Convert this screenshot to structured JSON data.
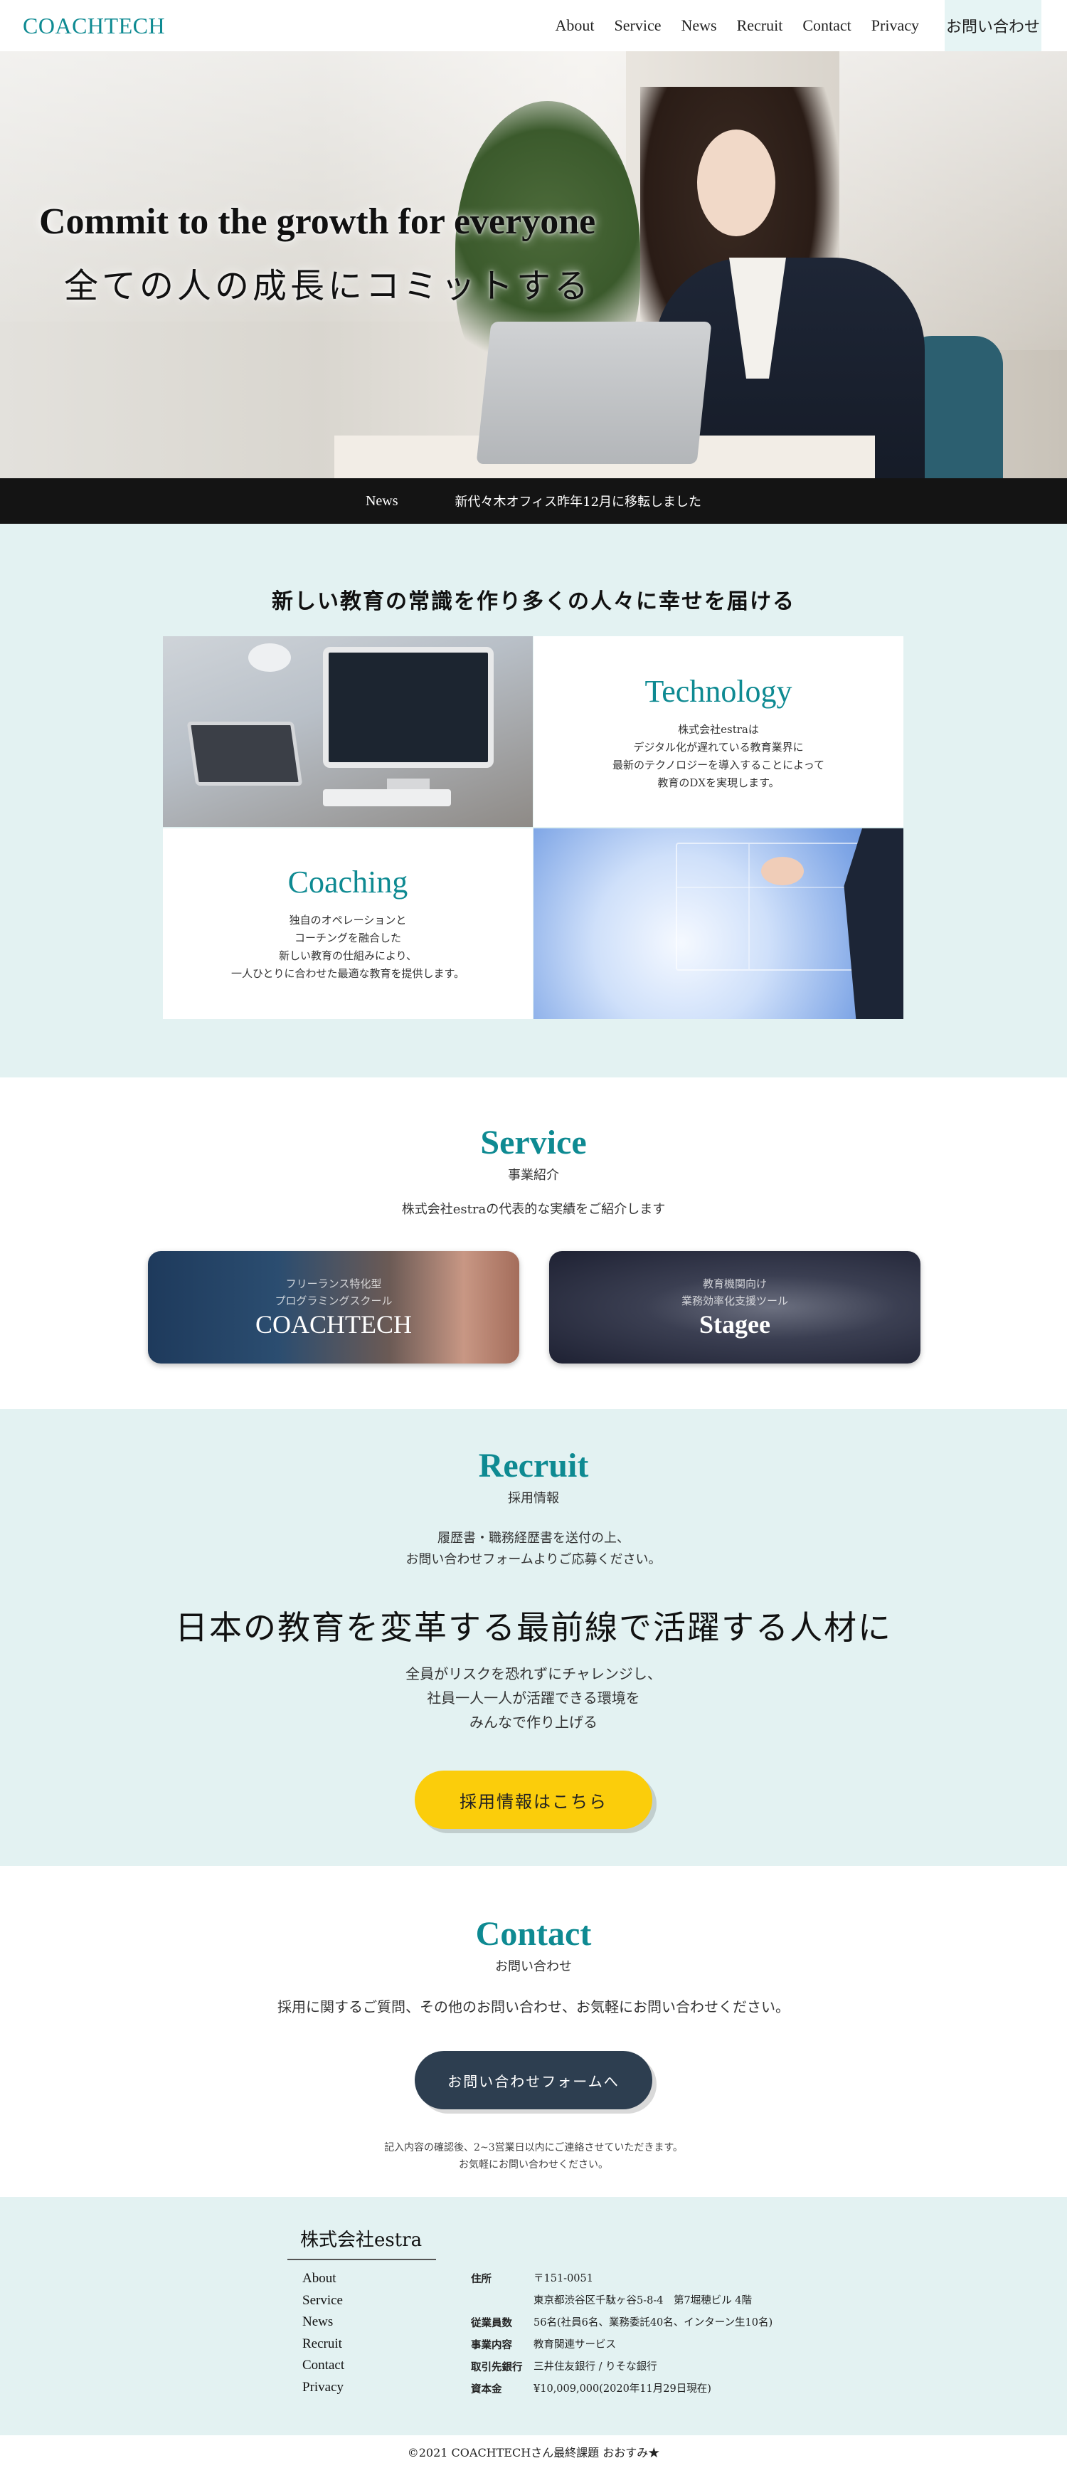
{
  "header": {
    "logo": "COACHTECH",
    "nav": [
      "About",
      "Service",
      "News",
      "Recruit",
      "Contact",
      "Privacy"
    ],
    "contact_button": "お問い合わせ"
  },
  "hero": {
    "title": "Commit to the growth for everyone",
    "subtitle": "全ての人の成長にコミットする"
  },
  "news": {
    "label": "News",
    "text": "新代々木オフィス昨年12月に移転しました"
  },
  "mission": {
    "heading": "新しい教育の常識を作り多くの人々に幸せを届ける",
    "technology": {
      "title": "Technology",
      "text": "株式会社estraは\nデジタル化が遅れている教育業界に\n最新のテクノロジーを導入することによって\n教育のDXを実現します。"
    },
    "coaching": {
      "title": "Coaching",
      "text": "独自のオペレーションと\nコーチングを融合した\n新しい教育の仕組みにより、\n一人ひとりに合わせた最適な教育を提供します。"
    }
  },
  "service": {
    "title": "Service",
    "subtitle": "事業紹介",
    "description": "株式会社estraの代表的な実績をご紹介します",
    "cards": [
      {
        "small": "フリーランス特化型\nプログラミングスクール",
        "name": "COACHTECH"
      },
      {
        "small": "教育機関向け\n業務効率化支援ツール",
        "name": "Stagee"
      }
    ]
  },
  "recruit": {
    "title": "Recruit",
    "subtitle": "採用情報",
    "description": "履歴書・職務経歴書を送付の上、\nお問い合わせフォームよりご応募ください。",
    "headline": "日本の教育を変革する最前線で活躍する人材に",
    "description2": "全員がリスクを恐れずにチャレンジし、\n社員一人一人が活躍できる環境を\nみんなで作り上げる",
    "button": "採用情報はこちら"
  },
  "contact": {
    "title": "Contact",
    "subtitle": "お問い合わせ",
    "description": "採用に関するご質問、その他のお問い合わせ、お気軽にお問い合わせください。",
    "button": "お問い合わせフォームへ",
    "note": "記入内容の確認後、2~3営業日以内にご連絡させていただきます。\nお気軽にお問い合わせください。"
  },
  "footer": {
    "company": "株式会社estra",
    "nav": [
      "About",
      "Service",
      "News",
      "Recruit",
      "Contact",
      "Privacy"
    ],
    "info": [
      {
        "key": "住所",
        "value": "〒151-0051"
      },
      {
        "key": "",
        "value": "東京都渋谷区千駄ヶ谷5-8-4　第7堀穂ビル 4階"
      },
      {
        "key": "従業員数",
        "value": "56名(社員6名、業務委託40名、インターン生10名)"
      },
      {
        "key": "事業内容",
        "value": "教育関連サービス"
      },
      {
        "key": "取引先銀行",
        "value": "三井住友銀行 / りそな銀行"
      },
      {
        "key": "資本金",
        "value": "¥10,009,000(2020年11月29日現在)"
      }
    ],
    "copyright": "©2021 COACHTECHさん最終課題 おおすみ★"
  },
  "colors": {
    "accent": "#0e8a92",
    "light_bg": "#e3f2f2",
    "news_bar": "#141414",
    "recruit_button": "#fbcd0b",
    "contact_button": "#2d3e50"
  }
}
